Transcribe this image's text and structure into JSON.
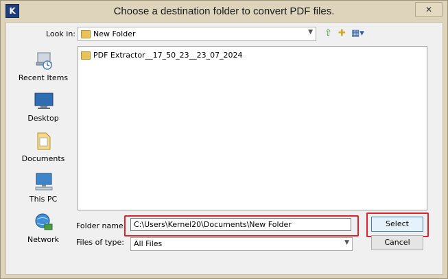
{
  "window": {
    "title": "Choose a destination folder to convert PDF files.",
    "app_icon_letter": "K",
    "close_glyph": "✕"
  },
  "lookin": {
    "label": "Look in:",
    "value": "New Folder"
  },
  "toolbar": {
    "up_icon": "up-folder-icon",
    "new_folder_icon": "new-folder-icon",
    "view_menu_icon": "view-menu-icon"
  },
  "places": [
    {
      "label": "Recent Items",
      "icon": "recent-items-icon"
    },
    {
      "label": "Desktop",
      "icon": "desktop-icon"
    },
    {
      "label": "Documents",
      "icon": "documents-icon"
    },
    {
      "label": "This PC",
      "icon": "this-pc-icon"
    },
    {
      "label": "Network",
      "icon": "network-icon"
    }
  ],
  "files": [
    {
      "name": "PDF Extractor__17_50_23__23_07_2024",
      "icon": "folder-icon"
    }
  ],
  "folder_name": {
    "label": "Folder name:",
    "value": "C:\\Users\\Kernel20\\Documents\\New Folder"
  },
  "files_of_type": {
    "label": "Files of type:",
    "value": "All Files"
  },
  "buttons": {
    "select": "Select",
    "cancel": "Cancel"
  },
  "colors": {
    "highlight": "#d9232d",
    "title_bar": "#ddd4bb",
    "folder": "#e8c25a"
  }
}
